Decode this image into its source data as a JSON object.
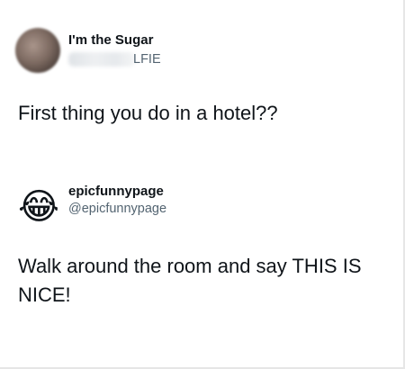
{
  "tweets": [
    {
      "display_name": "I'm the Sugar",
      "handle_visible": "LFIE",
      "text": "First thing you do in a hotel??"
    },
    {
      "avatar_glyph": "😂",
      "display_name": "epicfunnypage",
      "handle": "@epicfunnypage",
      "text": "Walk around the room and say THIS IS NICE!"
    }
  ],
  "colors": {
    "text": "#0f1419",
    "secondary": "#536471",
    "background": "#ffffff"
  },
  "icons": [
    "blurred-avatar",
    "face-with-tears-of-joy-emoji"
  ]
}
